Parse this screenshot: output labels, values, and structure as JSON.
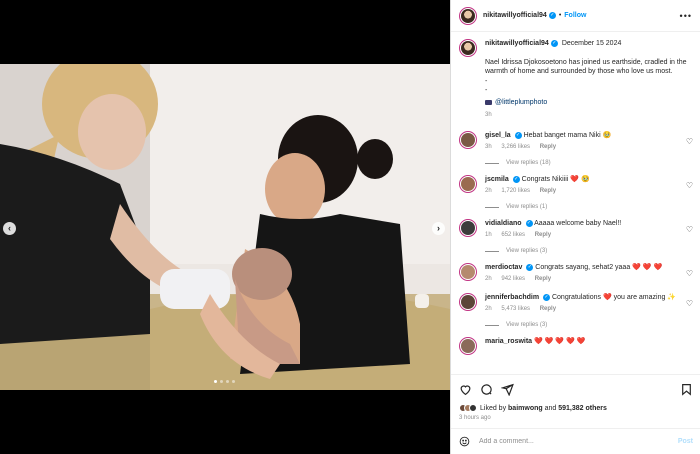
{
  "header": {
    "username": "nikitawillyofficial94",
    "separator": "•",
    "follow_label": "Follow",
    "more_icon": "more-horizontal-icon"
  },
  "caption": {
    "username": "nikitawillyofficial94",
    "date": "December 15 2024",
    "text": "Nael Idrissa Djokosoetono has joined us earthside, cradled in the warmth of home and surrounded by those who love us most.",
    "dash1": "-",
    "dash2": "-",
    "mention": "@littleplumphoto",
    "time": "3h"
  },
  "comments": [
    {
      "username": "gisel_la",
      "text": "Hebat banget mama Niki 🥹",
      "time": "3h",
      "likes": "3,266 likes",
      "reply_label": "Reply",
      "view_replies": "View replies (18)",
      "avatar_color": "#7a5a45"
    },
    {
      "username": "jscmila",
      "text": "Congrats Nikiiii ❤️ 🥹",
      "time": "2h",
      "likes": "1,720 likes",
      "reply_label": "Reply",
      "view_replies": "View replies (1)",
      "avatar_color": "#9a6b50"
    },
    {
      "username": "vidialdiano",
      "text": "Aaaaa welcome baby Nael!!",
      "time": "1h",
      "likes": "652 likes",
      "reply_label": "Reply",
      "view_replies": "View replies (3)",
      "avatar_color": "#3c3c3c"
    },
    {
      "username": "merdioctav",
      "text": "Congrats sayang, sehat2 yaaa ❤️ ❤️ ❤️",
      "time": "2h",
      "likes": "942 likes",
      "reply_label": "Reply",
      "view_replies": "",
      "avatar_color": "#b58a6e"
    },
    {
      "username": "jenniferbachdim",
      "text": "Congratulations ❤️ you are amazing ✨",
      "time": "2h",
      "likes": "5,473 likes",
      "reply_label": "Reply",
      "view_replies": "View replies (3)",
      "avatar_color": "#5c4538"
    },
    {
      "username": "maria_roswita",
      "text": "❤️ ❤️ ❤️ ❤️ ❤️",
      "time": "",
      "likes": "",
      "reply_label": "",
      "view_replies": "",
      "avatar_color": "#8a6a5a"
    }
  ],
  "actions": {
    "liked_by_prefix": "Liked by",
    "liked_by_user": "baimwong",
    "liked_by_and": "and",
    "liked_by_count": "591,382 others",
    "time_ago": "3 hours ago"
  },
  "add_comment": {
    "placeholder": "Add a comment...",
    "post_label": "Post"
  },
  "media": {
    "prev_icon": "chevron-left-icon",
    "next_icon": "chevron-right-icon",
    "slide_count": 4,
    "active_slide": 1
  }
}
